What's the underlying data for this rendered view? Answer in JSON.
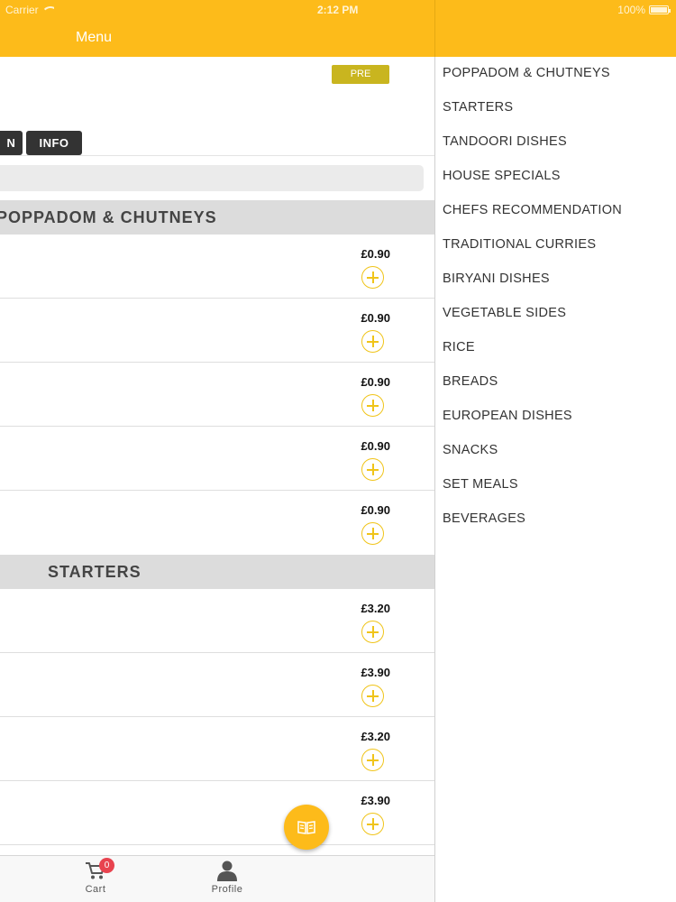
{
  "status_bar": {
    "carrier": "Carrier",
    "time": "2:12 PM",
    "battery": "100%"
  },
  "nav": {
    "title": "Menu"
  },
  "main": {
    "preorder_label": "PRE ORDER",
    "buttons": {
      "partial_label": "N",
      "info_label": "INFO"
    },
    "sections": [
      {
        "title": "POPPADOM & CHUTNEYS",
        "items": [
          {
            "price": "£0.90"
          },
          {
            "price": "£0.90"
          },
          {
            "price": "£0.90"
          },
          {
            "price": "£0.90"
          },
          {
            "price": "£0.90"
          }
        ]
      },
      {
        "title": "STARTERS",
        "items": [
          {
            "price": "£3.20"
          },
          {
            "price": "£3.90"
          },
          {
            "price": "£3.20"
          },
          {
            "price": "£3.90"
          }
        ]
      }
    ]
  },
  "tabbar": {
    "cart_label": "Cart",
    "cart_count": "0",
    "profile_label": "Profile"
  },
  "categories": [
    "POPPADOM & CHUTNEYS",
    "STARTERS",
    "TANDOORI DISHES",
    "HOUSE SPECIALS",
    "CHEFS RECOMMENDATION",
    "TRADITIONAL CURRIES",
    "BIRYANI DISHES",
    "VEGETABLE SIDES",
    "RICE",
    "BREADS",
    "EUROPEAN DISHES",
    "SNACKS",
    "SET MEALS",
    "BEVERAGES"
  ],
  "colors": {
    "accent": "#FDBB1A",
    "badge": "#C9B51F",
    "cart_badge": "#e8434f"
  },
  "icons": {
    "fab": "menu-book-icon",
    "cart": "cart-icon",
    "profile": "profile-icon"
  }
}
